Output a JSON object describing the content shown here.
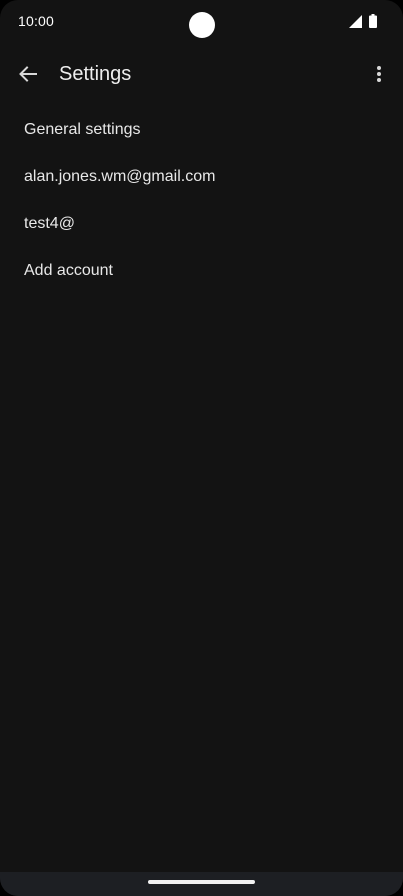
{
  "status_bar": {
    "time": "10:00",
    "icons": [
      "signal-icon",
      "battery-icon"
    ]
  },
  "app_bar": {
    "title": "Settings",
    "back_icon": "arrow-back-icon",
    "menu_icon": "more-vert-icon"
  },
  "settings_list": {
    "items": [
      {
        "label": "General settings"
      },
      {
        "label": "alan.jones.wm@gmail.com"
      },
      {
        "label": "test4@"
      },
      {
        "label": "Add account"
      }
    ]
  },
  "colors": {
    "background": "#131313",
    "text": "#e8e8e8",
    "nav_bar": "#1d1f23"
  }
}
